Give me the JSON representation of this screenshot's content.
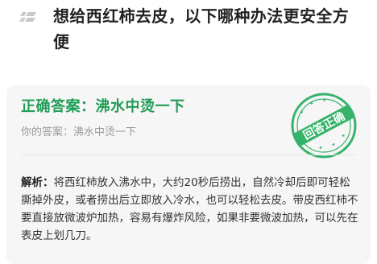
{
  "question": {
    "icon": "list-icon",
    "text": "想给西红柿去皮，以下哪种办法更安全方便"
  },
  "answer_card": {
    "correct_answer": "正确答案：沸水中烫一下",
    "your_answer_label": "你的答案：",
    "your_answer_value": "沸水中烫一下",
    "explanation_label": "解析：",
    "explanation_text": "将西红柿放入沸水中，大约20秒后捞出，自然冷却后即可轻松撕掉外皮，或者捞出后立即放入冷水，也可以轻松去皮。带皮西红柿不要直接放微波炉加热，容易有爆炸风险，如果非要微波加热，可以先在表皮上划几刀。",
    "stamp_text": "回答正确"
  },
  "colors": {
    "accent_green": "#1f9d55",
    "stamp_green": "#35b36b",
    "card_background": "#f6f6f6"
  }
}
